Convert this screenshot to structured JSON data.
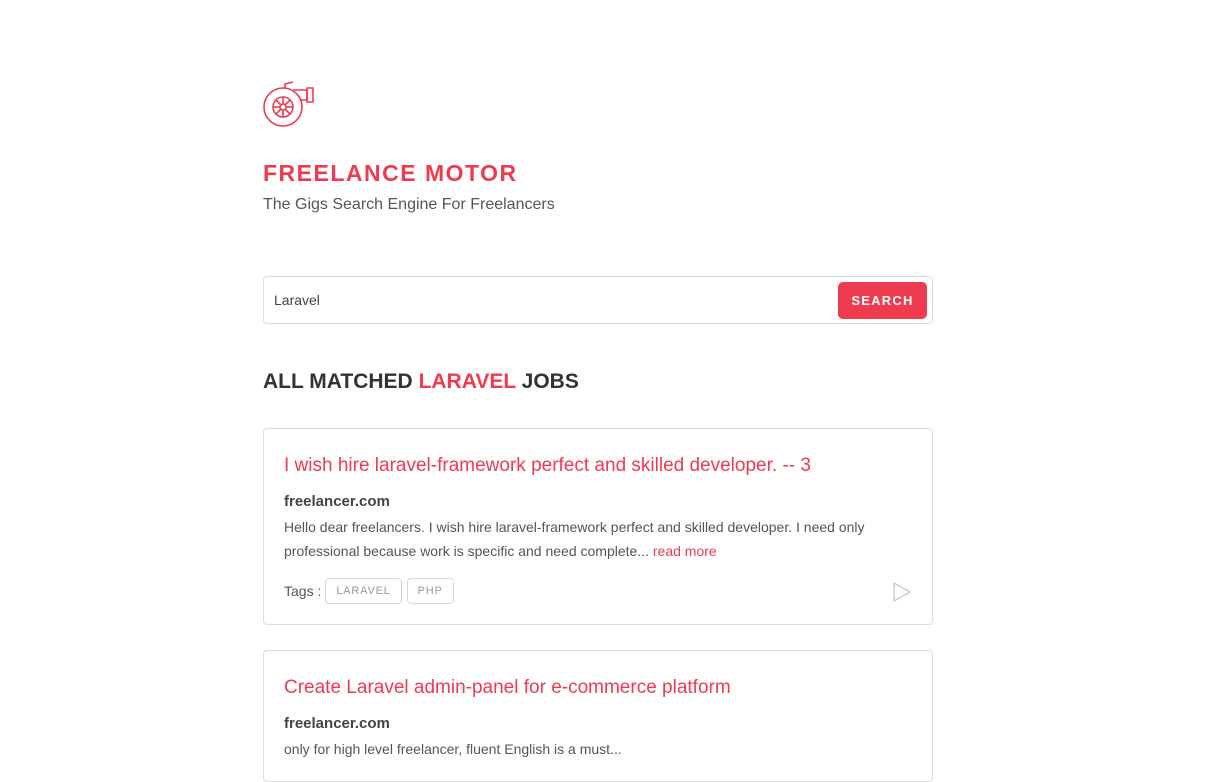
{
  "brand": {
    "logo_icon": "turbo-engine-icon",
    "name": "FREELANCE MOTOR",
    "tagline": "The Gigs Search Engine For Freelancers"
  },
  "search": {
    "value": "Laravel",
    "button_label": "SEARCH"
  },
  "results": {
    "heading_prefix": "ALL MATCHED",
    "heading_keyword": "LARAVEL",
    "heading_suffix": "JOBS"
  },
  "jobs": [
    {
      "title": "I wish hire laravel-framework perfect and skilled developer. -- 3",
      "source": "freelancer.com",
      "description": "Hello dear freelancers. I wish hire laravel-framework perfect and skilled developer. I need only professional because work is specific and need complete...",
      "read_more": "read more",
      "tags_label": "Tags :",
      "tags": [
        "LARAVEL",
        "PHP"
      ],
      "action_icon": "play-icon"
    },
    {
      "title": "Create Laravel admin-panel for e-commerce platform",
      "source": "freelancer.com",
      "description": "only for high level freelancer, fluent English is a must..."
    }
  ],
  "colors": {
    "accent": "#ef3b50",
    "text": "#444444",
    "border": "#dcdcdc"
  }
}
